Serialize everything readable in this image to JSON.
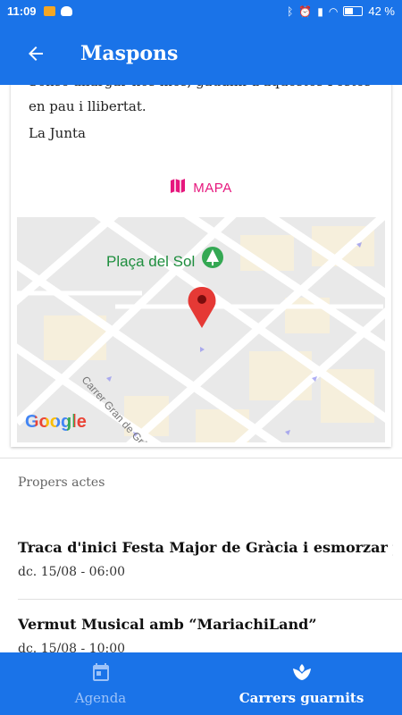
{
  "status_bar": {
    "time": "11:09",
    "battery": "42 %"
  },
  "app_bar": {
    "title": "Maspons",
    "back_icon": "arrow-back-icon"
  },
  "article": {
    "line_cut": "Sense allargar-nos més, gaudim d'aquestes Festes",
    "line_2": "en pau i llibertat.",
    "signature": "La Junta"
  },
  "map_button": {
    "label": "MAPA",
    "icon": "map-icon"
  },
  "map": {
    "place_label": "Plaça del Sol",
    "street_label": "Carrer Gran de Gràcia",
    "attribution": "Google"
  },
  "upcoming": {
    "section_title": "Propers actes",
    "events": [
      {
        "title": "Traca d'inici Festa Major de Gràcia i esmorzar popular",
        "date": "dc. 15/08 - 06:00"
      },
      {
        "title": "Vermut Musical amb “MariachiLand”",
        "date": "dc. 15/08 - 10:00"
      }
    ]
  },
  "bottom_nav": {
    "items": [
      {
        "label": "Agenda",
        "icon": "calendar-icon",
        "active": false
      },
      {
        "label": "Carrers guarnits",
        "icon": "flower-icon",
        "active": true
      }
    ]
  },
  "colors": {
    "primary": "#1a73e8",
    "accent": "#e6177d",
    "park_green": "#1e8e3e",
    "pin_red": "#e53935"
  }
}
